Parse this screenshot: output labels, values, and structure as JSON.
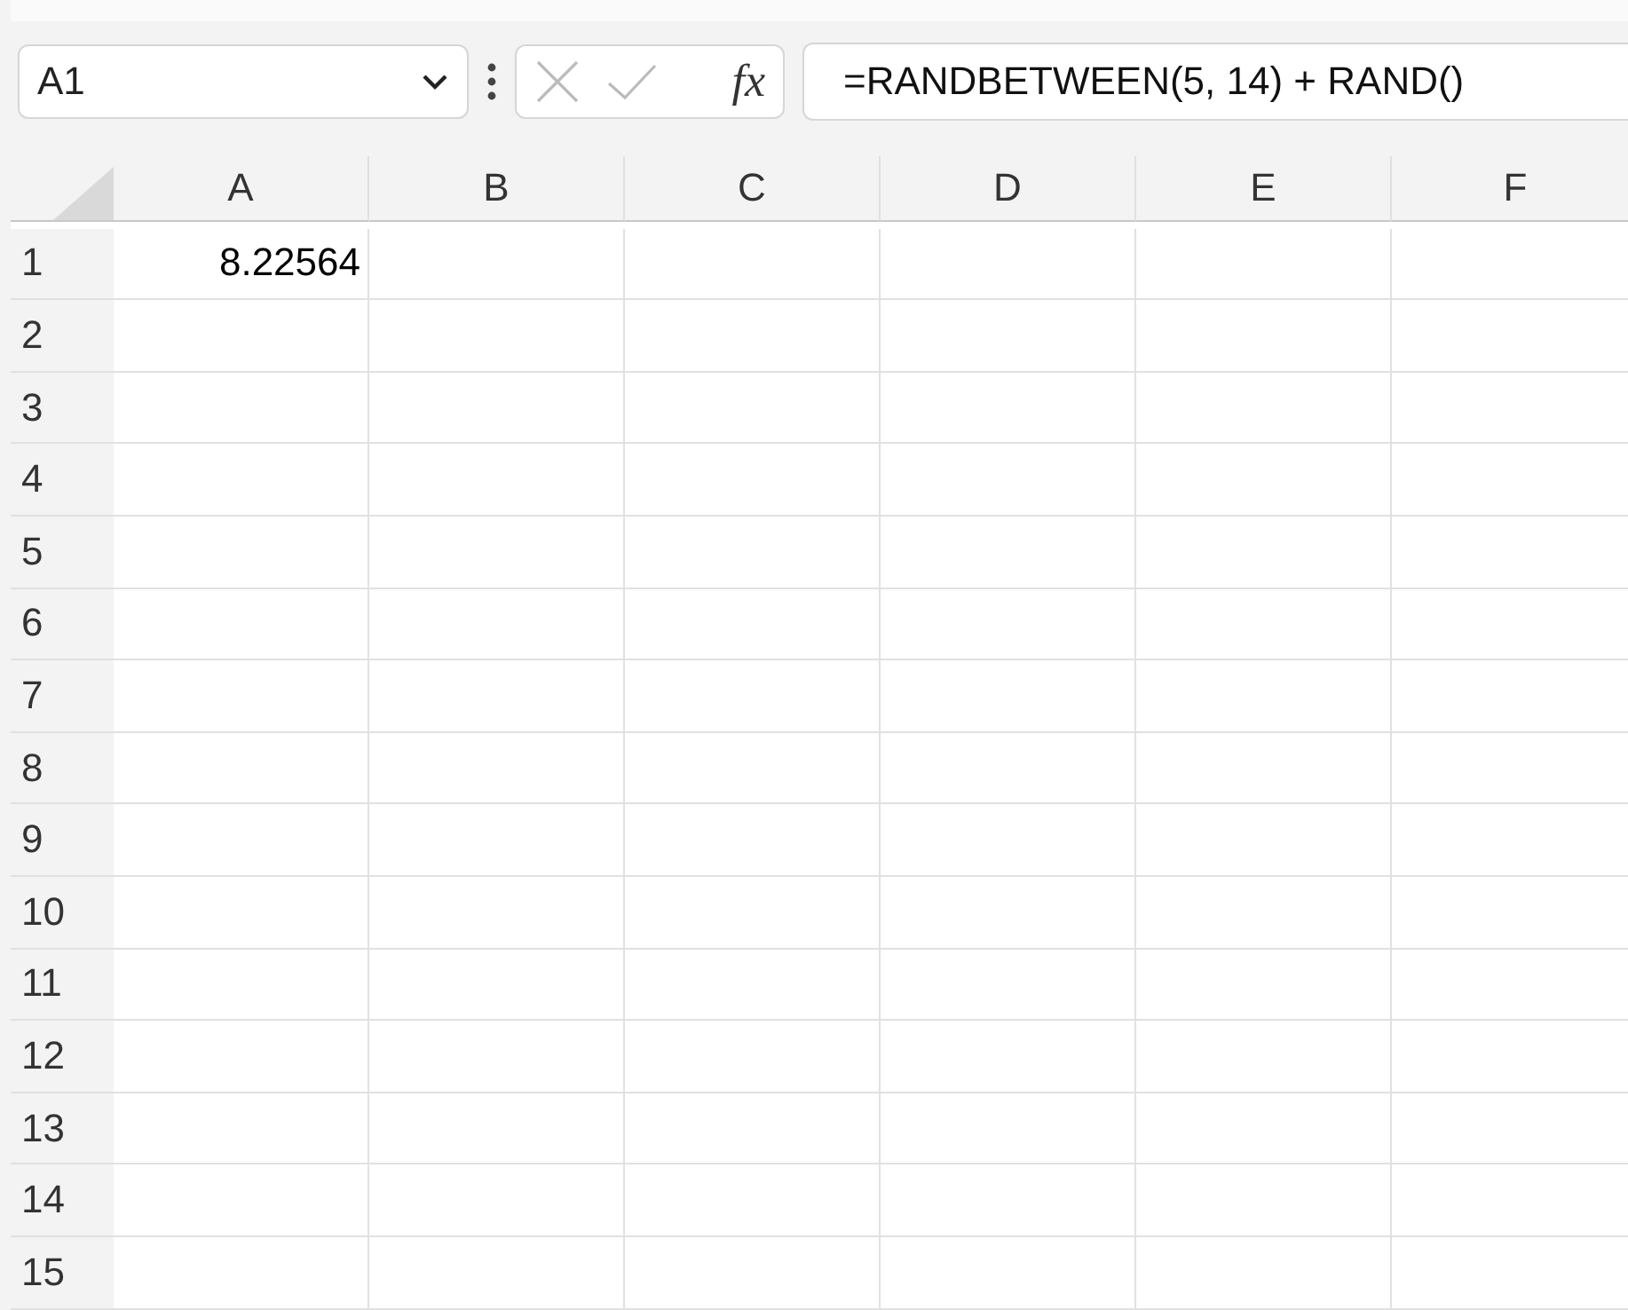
{
  "name_box": {
    "value": "A1"
  },
  "function_button": "fx",
  "formula_bar": {
    "value": "=RANDBETWEEN(5, 14) + RAND()"
  },
  "columns": [
    "A",
    "B",
    "C",
    "D",
    "E",
    "F"
  ],
  "rows": [
    {
      "number": "1",
      "cells": [
        "8.22564",
        "",
        "",
        "",
        "",
        ""
      ]
    },
    {
      "number": "2",
      "cells": [
        "",
        "",
        "",
        "",
        "",
        ""
      ]
    },
    {
      "number": "3",
      "cells": [
        "",
        "",
        "",
        "",
        "",
        ""
      ]
    },
    {
      "number": "4",
      "cells": [
        "",
        "",
        "",
        "",
        "",
        ""
      ]
    },
    {
      "number": "5",
      "cells": [
        "",
        "",
        "",
        "",
        "",
        ""
      ]
    },
    {
      "number": "6",
      "cells": [
        "",
        "",
        "",
        "",
        "",
        ""
      ]
    },
    {
      "number": "7",
      "cells": [
        "",
        "",
        "",
        "",
        "",
        ""
      ]
    },
    {
      "number": "8",
      "cells": [
        "",
        "",
        "",
        "",
        "",
        ""
      ]
    },
    {
      "number": "9",
      "cells": [
        "",
        "",
        "",
        "",
        "",
        ""
      ]
    },
    {
      "number": "10",
      "cells": [
        "",
        "",
        "",
        "",
        "",
        ""
      ]
    },
    {
      "number": "11",
      "cells": [
        "",
        "",
        "",
        "",
        "",
        ""
      ]
    },
    {
      "number": "12",
      "cells": [
        "",
        "",
        "",
        "",
        "",
        ""
      ]
    },
    {
      "number": "13",
      "cells": [
        "",
        "",
        "",
        "",
        "",
        ""
      ]
    },
    {
      "number": "14",
      "cells": [
        "",
        "",
        "",
        "",
        "",
        ""
      ]
    },
    {
      "number": "15",
      "cells": [
        "",
        "",
        "",
        "",
        "",
        ""
      ]
    }
  ]
}
